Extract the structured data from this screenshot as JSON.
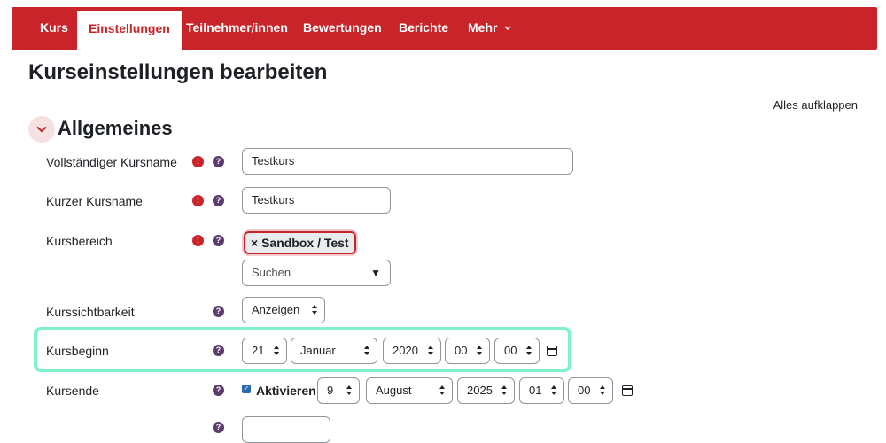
{
  "nav": {
    "tabs": [
      "Kurs",
      "Einstellungen",
      "Teilnehmer/innen",
      "Bewertungen",
      "Berichte",
      "Mehr"
    ]
  },
  "page": {
    "title": "Kurseinstellungen bearbeiten",
    "expand_all": "Alles aufklappen"
  },
  "section": {
    "title": "Allgemeines"
  },
  "fields": {
    "fullname": {
      "label": "Vollständiger Kursname",
      "value": "Testkurs"
    },
    "shortname": {
      "label": "Kurzer Kursname",
      "value": "Testkurs"
    },
    "category": {
      "label": "Kursbereich",
      "selected": "× Sandbox / Test",
      "search_placeholder": "Suchen"
    },
    "visibility": {
      "label": "Kurssichtbarkeit",
      "value": "Anzeigen"
    },
    "startdate": {
      "label": "Kursbeginn",
      "day": "21",
      "month": "Januar",
      "year": "2020",
      "hour": "00",
      "minute": "00"
    },
    "enddate": {
      "label": "Kursende",
      "enable_label": "Aktivieren",
      "day": "9",
      "month": "August",
      "year": "2025",
      "hour": "01",
      "minute": "00"
    }
  },
  "icons": {
    "required": "!",
    "help": "?",
    "checkmark": "✓",
    "dropdown_caret": "▼",
    "chevron": "⌄"
  },
  "colors": {
    "brand": "#c8242a",
    "help": "#5c3b6e",
    "highlight": "#7ef2c8"
  }
}
